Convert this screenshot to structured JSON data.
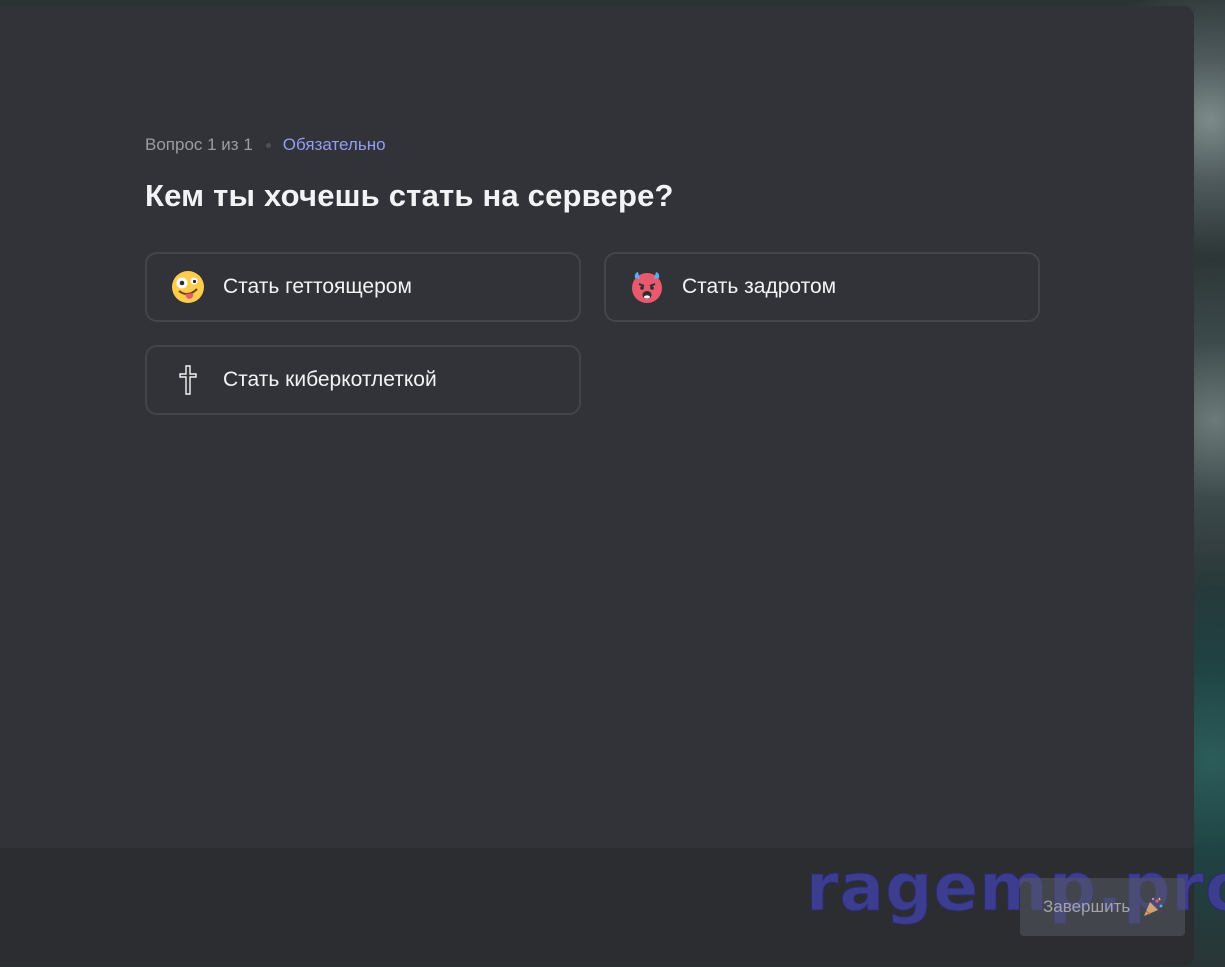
{
  "header": {
    "counter": "Вопрос 1 из 1",
    "required_label": "Обязательно"
  },
  "question": {
    "title": "Кем ты хочешь стать на сервере?"
  },
  "options": [
    {
      "label": "Стать геттоящером",
      "icon": "zany-face-icon"
    },
    {
      "label": "Стать задротом",
      "icon": "hot-face-icon"
    },
    {
      "label": "Стать киберкотлеткой",
      "icon": "latin-cross-icon"
    }
  ],
  "footer": {
    "finish_label": "Завершить",
    "finish_icon": "party-popper-icon"
  },
  "watermark": {
    "text": "ragemp.pro"
  },
  "colors": {
    "modal_bg": "#313338",
    "footer_bg": "#2b2d31",
    "accent": "#949cf7",
    "option_border": "#43454b",
    "watermark": "#3c3d8e"
  }
}
